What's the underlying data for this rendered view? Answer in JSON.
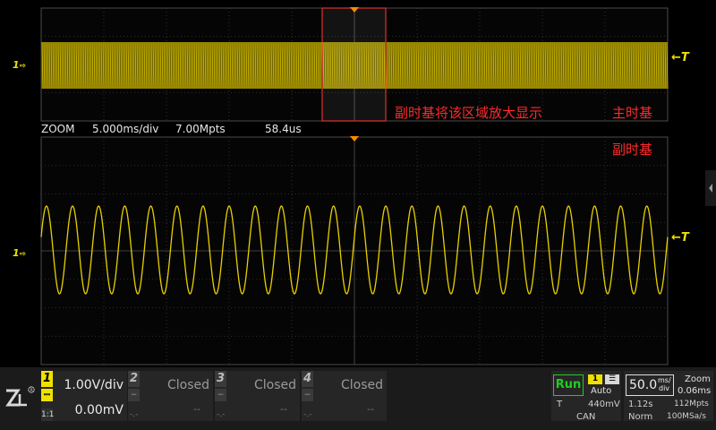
{
  "colors": {
    "trace": "#e8d000",
    "trace_fill": "#6b6000",
    "annotation": "#ff2a2a",
    "grid": "#3a3a3a",
    "grid_dot": "#5a5a5a",
    "ch1": "#f0e000",
    "run": "#22cc22"
  },
  "main_view": {
    "channel_marker": "1",
    "trigger_marker": "T",
    "annotation_zoom_region": "副时基将该区域放大显示",
    "annotation_main": "主时基"
  },
  "zoom_bar": {
    "mode": "ZOOM",
    "timebase": "5.000ms/div",
    "memory": "7.00Mpts",
    "delay": "58.4us"
  },
  "zoom_view": {
    "channel_marker": "1",
    "trigger_marker": "T",
    "annotation": "副时基",
    "sine_cycles": 24
  },
  "channels": [
    {
      "num": "1",
      "scale": "1.00V/div",
      "offset": "0.00mV",
      "coupling": "1:1",
      "state": "on"
    },
    {
      "num": "2",
      "status": "Closed",
      "value": "--",
      "coupling": "-.-"
    },
    {
      "num": "3",
      "status": "Closed",
      "value": "--",
      "coupling": "-.-"
    },
    {
      "num": "4",
      "status": "Closed",
      "value": "--",
      "coupling": "-.-"
    }
  ],
  "status": {
    "run_state": "Run",
    "trigger_source": "1",
    "trigger_mode": "Auto",
    "trigger_label": "T",
    "trigger_level": "440mV",
    "bus": "CAN",
    "timebase_value": "50.0",
    "timebase_unit_top": "ms/",
    "timebase_unit_bottom": "div",
    "acq_time": "1.12s",
    "acq_mode": "Norm",
    "zoom_label": "Zoom",
    "zoom_time": "0.06ms",
    "zoom_pts": "112Mpts",
    "sample_rate": "100MSa/s"
  }
}
